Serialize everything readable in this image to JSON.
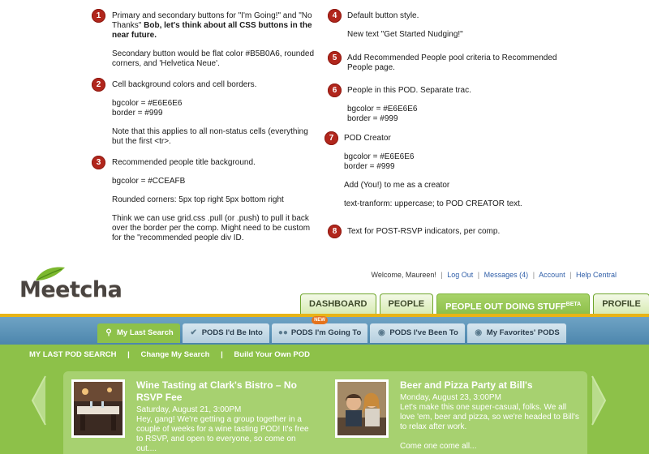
{
  "notes": [
    {
      "number": "1",
      "lead_text": "Primary and secondary buttons for \"I'm Going!\" and \"No Thanks\" ",
      "lead_bold": "Bob, let's think about all CSS buttons in the near future.",
      "paragraphs": [
        "Secondary button would be flat color #B5B0A6, rounded corners, and 'Helvetica Neue'."
      ]
    },
    {
      "number": "2",
      "lead_text": "Cell background colors and cell borders.",
      "paragraphs": [
        "bgcolor = #E6E6E6\nborder = #999",
        "Note that this applies to all non-status cells (everything but the first <tr>."
      ]
    },
    {
      "number": "3",
      "lead_text": "Recommended people title background.",
      "paragraphs": [
        "bgcolor = #CCEAFB",
        "Rounded corners: 5px top right 5px bottom right",
        "Think we can use grid.css .pull (or .push) to pull it back over the border per the comp. Might need to be custom for the \"recommended people div ID."
      ]
    },
    {
      "number": "4",
      "lead_text": "Default button style.",
      "paragraphs": [
        "New text \"Get Started Nudging!\""
      ]
    },
    {
      "number": "5",
      "lead_text": "Add Recommended People pool criteria to Recommended People page.",
      "paragraphs": []
    },
    {
      "number": "6",
      "lead_text": "People in this POD. Separate trac.",
      "paragraphs": [
        "bgcolor = #E6E6E6\nborder = #999"
      ]
    },
    {
      "number": "7",
      "lead_text": "POD Creator",
      "paragraphs": [
        "bgcolor = #E6E6E6\nborder = #999",
        "Add (You!) to me as a creator",
        "text-tranform: uppercase; to POD CREATOR text."
      ]
    },
    {
      "number": "8",
      "lead_text": "Text for POST-RSVP indicators, per comp.",
      "paragraphs": []
    }
  ],
  "app": {
    "logo": "Meetcha",
    "topnav": {
      "welcome": "Welcome, Maureen!",
      "logout": "Log Out",
      "messages": "Messages (4)",
      "account": "Account",
      "help": "Help Central",
      "separator": "|"
    },
    "main_tabs": [
      {
        "label": "Dashboard"
      },
      {
        "label": "People"
      },
      {
        "label": "People Out Doing Stuff",
        "sup": "BETA"
      },
      {
        "label": "Profile"
      }
    ],
    "sub_tabs": [
      {
        "label": "My Last Search",
        "icon": "search-icon"
      },
      {
        "label": "PODS I'd Be Into",
        "icon": "check-icon"
      },
      {
        "label": "PODS I'm Going To",
        "icon": "people-icon",
        "badge": "NEW"
      },
      {
        "label": "PODS I've Been To",
        "icon": "eye-icon"
      },
      {
        "label": "My Favorites' PODS",
        "icon": "eye-icon"
      }
    ],
    "sub_nav": {
      "items": [
        "MY LAST POD SEARCH",
        "Change My Search",
        "Build Your Own POD"
      ],
      "separator": "|"
    },
    "cards": [
      {
        "title": "Wine Tasting at Clark's Bistro – No RSVP Fee",
        "date": "Saturday, August 21, 3:00PM",
        "description": "Hey, gang! We're getting a group together in a couple of weeks for a wine tasting POD! It's free to RSVP, and open to everyone, so come on out...."
      },
      {
        "title": "Beer and Pizza Party at Bill's",
        "date": "Monday, August 23, 3:00PM",
        "description": "Let's make this one super-casual, folks. We all love 'em, beer and pizza, so we're headed to Bill's to relax after work.",
        "extra": "Come one come all..."
      }
    ]
  }
}
